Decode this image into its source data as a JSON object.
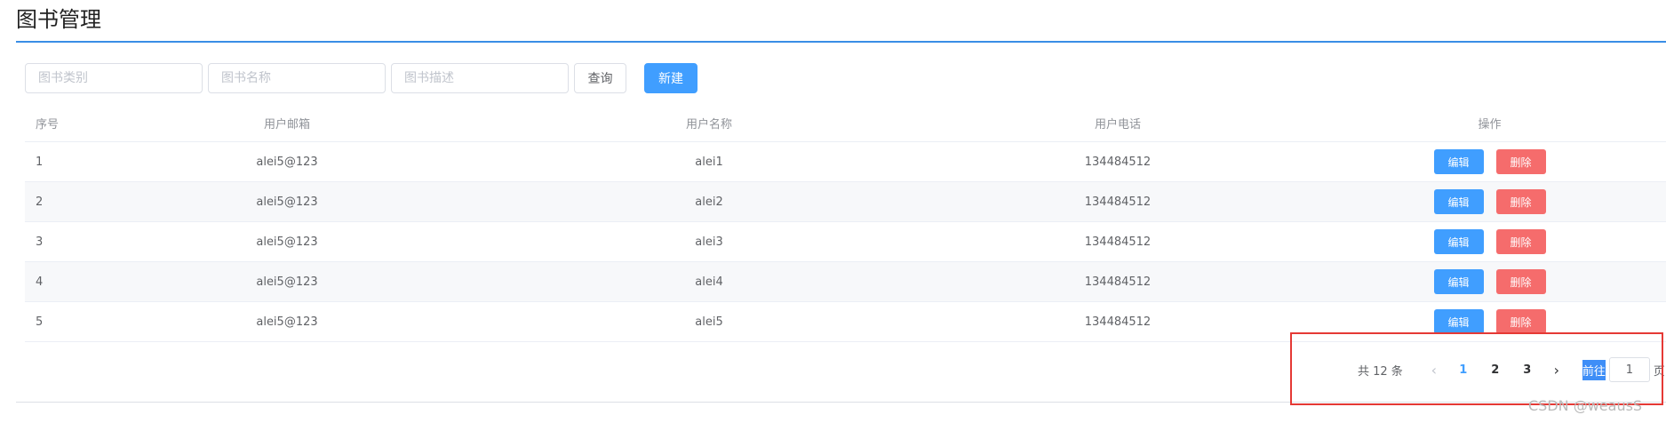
{
  "header": {
    "title": "图书管理"
  },
  "filters": {
    "category_placeholder": "图书类别",
    "name_placeholder": "图书名称",
    "desc_placeholder": "图书描述",
    "query_label": "查询",
    "create_label": "新建"
  },
  "table": {
    "columns": [
      "序号",
      "用户邮箱",
      "用户名称",
      "用户电话",
      "操作"
    ],
    "rows": [
      {
        "idx": "1",
        "email": "alei5@123",
        "name": "alei1",
        "phone": "134484512"
      },
      {
        "idx": "2",
        "email": "alei5@123",
        "name": "alei2",
        "phone": "134484512"
      },
      {
        "idx": "3",
        "email": "alei5@123",
        "name": "alei3",
        "phone": "134484512"
      },
      {
        "idx": "4",
        "email": "alei5@123",
        "name": "alei4",
        "phone": "134484512"
      },
      {
        "idx": "5",
        "email": "alei5@123",
        "name": "alei5",
        "phone": "134484512"
      }
    ],
    "edit_label": "编辑",
    "delete_label": "删除"
  },
  "pagination": {
    "total_text": "共 12 条",
    "pages": [
      "1",
      "2",
      "3"
    ],
    "current": "1",
    "goto_label": "前往",
    "goto_value": "1",
    "goto_suffix": "页"
  },
  "watermark": "CSDN @weausS",
  "colors": {
    "primary": "#409eff",
    "danger": "#f56c6c",
    "highlight": "#e53935"
  },
  "icons": {
    "prev": "chevron-left-icon",
    "next": "chevron-right-icon"
  }
}
